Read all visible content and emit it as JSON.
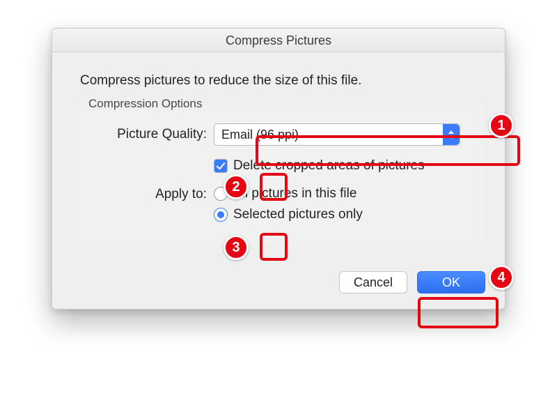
{
  "dialog": {
    "title": "Compress Pictures",
    "intro": "Compress pictures to reduce the size of this file.",
    "group_label": "Compression Options",
    "quality_label": "Picture Quality:",
    "quality_value": "Email (96 ppi)",
    "delete_crop_label": "Delete cropped areas of pictures",
    "delete_crop_checked": "true",
    "apply_to_label": "Apply to:",
    "radio_all": "All pictures in this file",
    "radio_selected": "Selected pictures only",
    "cancel": "Cancel",
    "ok": "OK"
  },
  "annotations": {
    "b1": "1",
    "b2": "2",
    "b3": "3",
    "b4": "4"
  }
}
